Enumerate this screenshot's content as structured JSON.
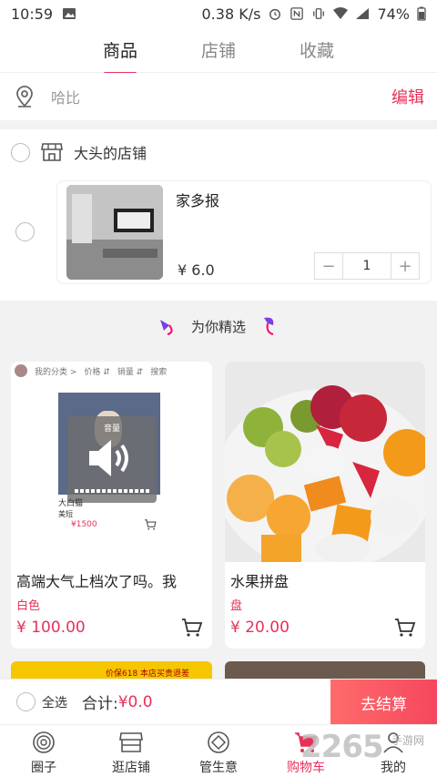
{
  "status_bar": {
    "time": "10:59",
    "speed": "0.38 K/s",
    "battery": "74%"
  },
  "tabs": [
    {
      "label": "商品",
      "active": true
    },
    {
      "label": "店铺",
      "active": false
    },
    {
      "label": "收藏",
      "active": false
    }
  ],
  "location": {
    "text": "哈比",
    "edit_label": "编辑"
  },
  "shop": {
    "name": "大头的店铺",
    "item": {
      "title": "家多报",
      "price": "¥ 6.0",
      "quantity": "1",
      "minus": "−",
      "plus": "+"
    }
  },
  "picks": {
    "title": "为你精选"
  },
  "products": [
    {
      "title": "高端大气上档次了吗。我",
      "sub": "白色",
      "price": "¥ 100.00",
      "mini": {
        "cat": "我的分类 >",
        "price": "价格 ⇵",
        "sales": "销量 ⇵",
        "search": "搜索",
        "volume": "音量",
        "name": "大白猫",
        "sub": "美短",
        "price_tag": "¥1500"
      }
    },
    {
      "title": "水果拼盘",
      "sub": "盘",
      "price": "¥ 20.00"
    }
  ],
  "peek": {
    "text": "价保618 本店买贵退差"
  },
  "bottom": {
    "select_all": "全选",
    "total_label": "合计:",
    "total": "¥0.0",
    "checkout": "去结算"
  },
  "nav": [
    {
      "label": "圈子",
      "icon": "circle-icon",
      "active": false
    },
    {
      "label": "逛店铺",
      "icon": "store-icon",
      "active": false
    },
    {
      "label": "管生意",
      "icon": "diamond-icon",
      "active": false
    },
    {
      "label": "购物车",
      "icon": "cart-icon",
      "active": true
    },
    {
      "label": "我的",
      "icon": "user-icon",
      "active": false
    }
  ],
  "watermark": {
    "text": "2265",
    "sub": "手游网"
  },
  "colors": {
    "accent": "#e8305a",
    "checkout_start": "#ff6b6b",
    "checkout_end": "#f5475e"
  }
}
